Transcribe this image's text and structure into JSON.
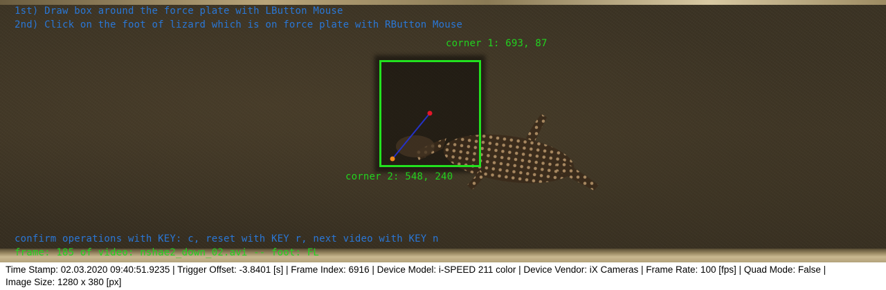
{
  "overlay": {
    "instruction_1": "1st) Draw box around the force plate with LButton Mouse",
    "instruction_2": "2nd) Click on the foot of lizard which is on force plate with RButton Mouse",
    "corner_1": "corner 1: 693, 87",
    "corner_2": "corner 2: 548, 240",
    "confirm": "confirm operations with KEY: c, reset with KEY r, next video with KEY n",
    "frame_info": "frame: 185 of video: nshae2_down_02.avi -- foot: FL"
  },
  "status_bar": {
    "line_1": "Time Stamp: 02.03.2020 09:40:51.9235  |  Trigger Offset: -3.8401 [s]  |  Frame Index: 6916  |  Device Model: i-SPEED 211 color  |  Device Vendor: iX Cameras  |  Frame Rate: 100 [fps]  |  Quad Mode: False  |",
    "line_2": "Image Size: 1280 x 380 [px]"
  },
  "colors": {
    "box": "#22e11f",
    "instruction_text": "#2a77d6",
    "info_text": "#22d21f",
    "marker_start": "#f08a1c",
    "marker_end": "#e3162a",
    "vector_line": "#2432c8"
  }
}
